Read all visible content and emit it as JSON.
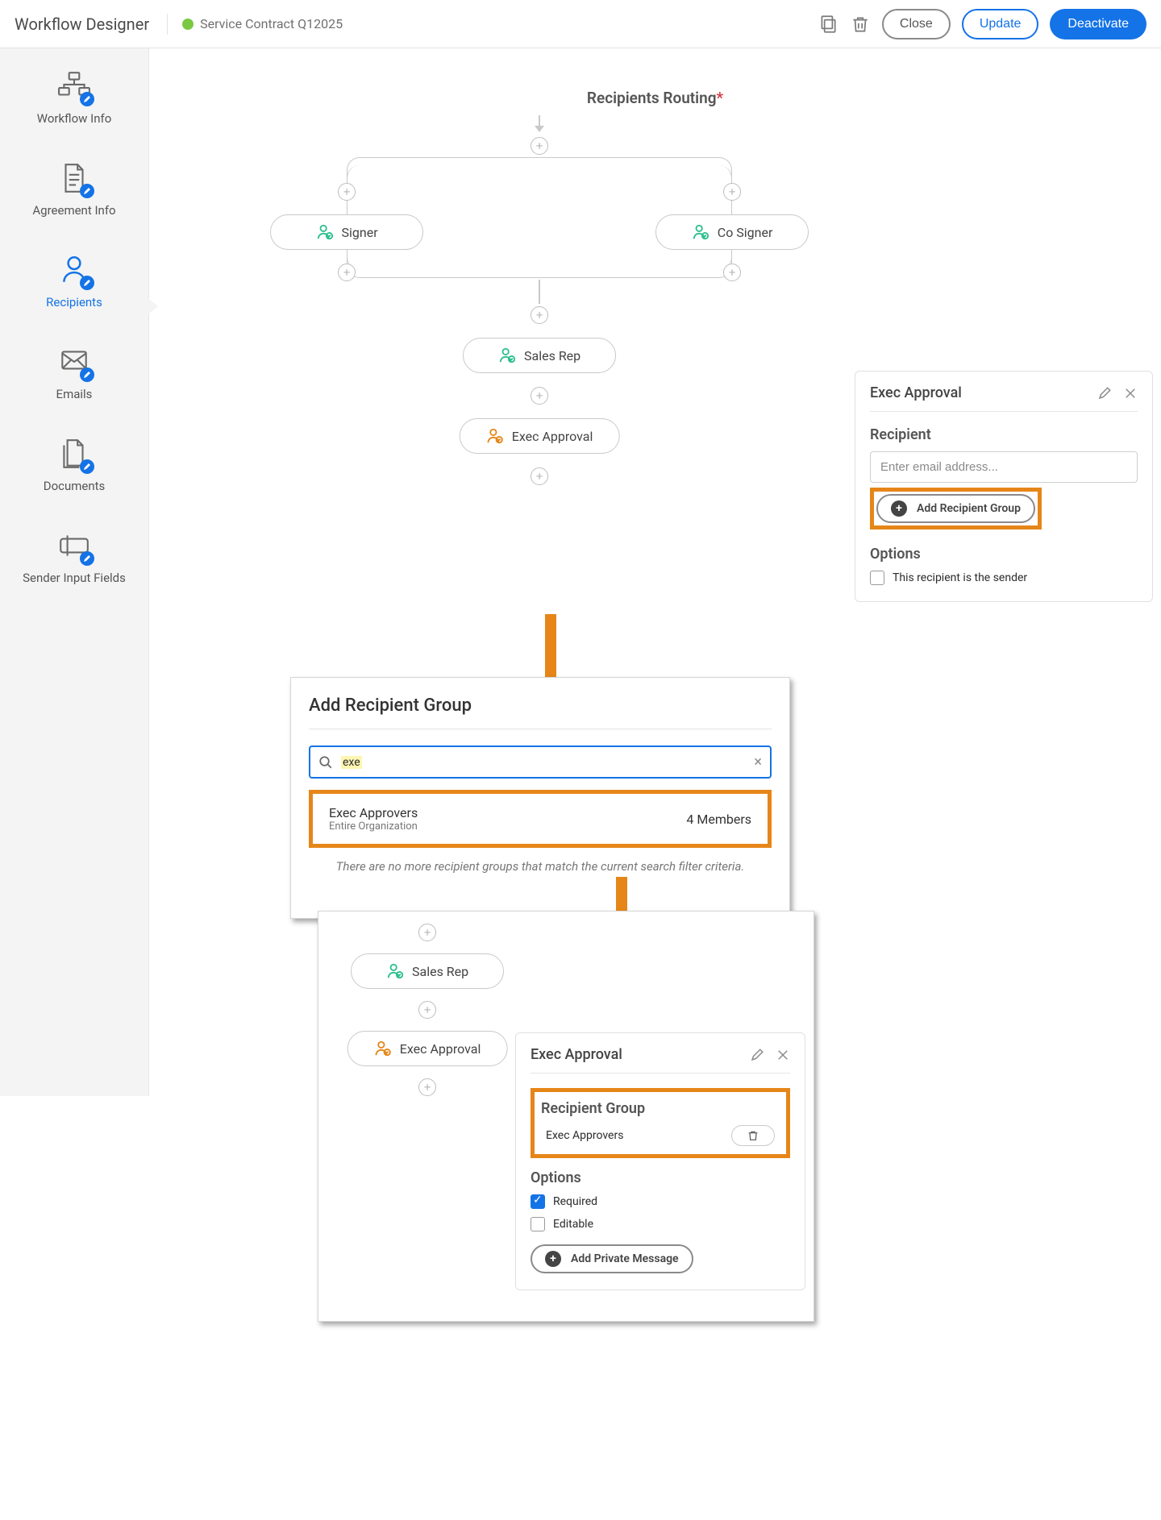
{
  "header": {
    "title": "Workflow Designer",
    "workflow_name": "Service Contract Q12025",
    "close": "Close",
    "update": "Update",
    "deactivate": "Deactivate"
  },
  "sidebar": {
    "items": [
      {
        "label": "Workflow Info"
      },
      {
        "label": "Agreement Info"
      },
      {
        "label": "Recipients"
      },
      {
        "label": "Emails"
      },
      {
        "label": "Documents"
      },
      {
        "label": "Sender Input Fields"
      }
    ]
  },
  "routing": {
    "title": "Recipients Routing",
    "nodes": {
      "signer": "Signer",
      "cosigner": "Co Signer",
      "salesrep": "Sales Rep",
      "execapproval": "Exec Approval"
    }
  },
  "panel1": {
    "title": "Exec Approval",
    "recipient_head": "Recipient",
    "email_placeholder": "Enter email address...",
    "add_group": "Add Recipient Group",
    "options_head": "Options",
    "chk_sender": "This recipient is the sender"
  },
  "dlg": {
    "title": "Add Recipient Group",
    "query": "exe",
    "result_name": "Exec Approvers",
    "result_sub": "Entire Organization",
    "result_members": "4 Members",
    "empty": "There are no more recipient groups that match the current search filter criteria."
  },
  "panel2": {
    "flow": {
      "salesrep": "Sales Rep",
      "execapproval": "Exec Approval"
    },
    "title": "Exec Approval",
    "group_head": "Recipient Group",
    "group_name": "Exec Approvers",
    "options_head": "Options",
    "chk_required": "Required",
    "chk_editable": "Editable",
    "private_msg": "Add Private Message"
  }
}
